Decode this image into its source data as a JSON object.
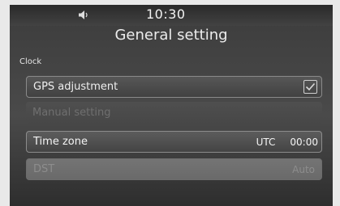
{
  "status_bar": {
    "time": "10:30",
    "volume_icon": "speaker-icon"
  },
  "title": "General setting",
  "section_label": "Clock",
  "rows": [
    {
      "label": "GPS adjustment",
      "checked": true
    },
    {
      "label": "Manual setting"
    },
    {
      "label": "Time zone",
      "value_prefix": "UTC",
      "value": "00:00"
    },
    {
      "label": "DST",
      "value": "Auto"
    }
  ],
  "colors": {
    "background": "#3f3f3f",
    "text": "#ececec",
    "disabled_text": "#6f6f6f"
  }
}
